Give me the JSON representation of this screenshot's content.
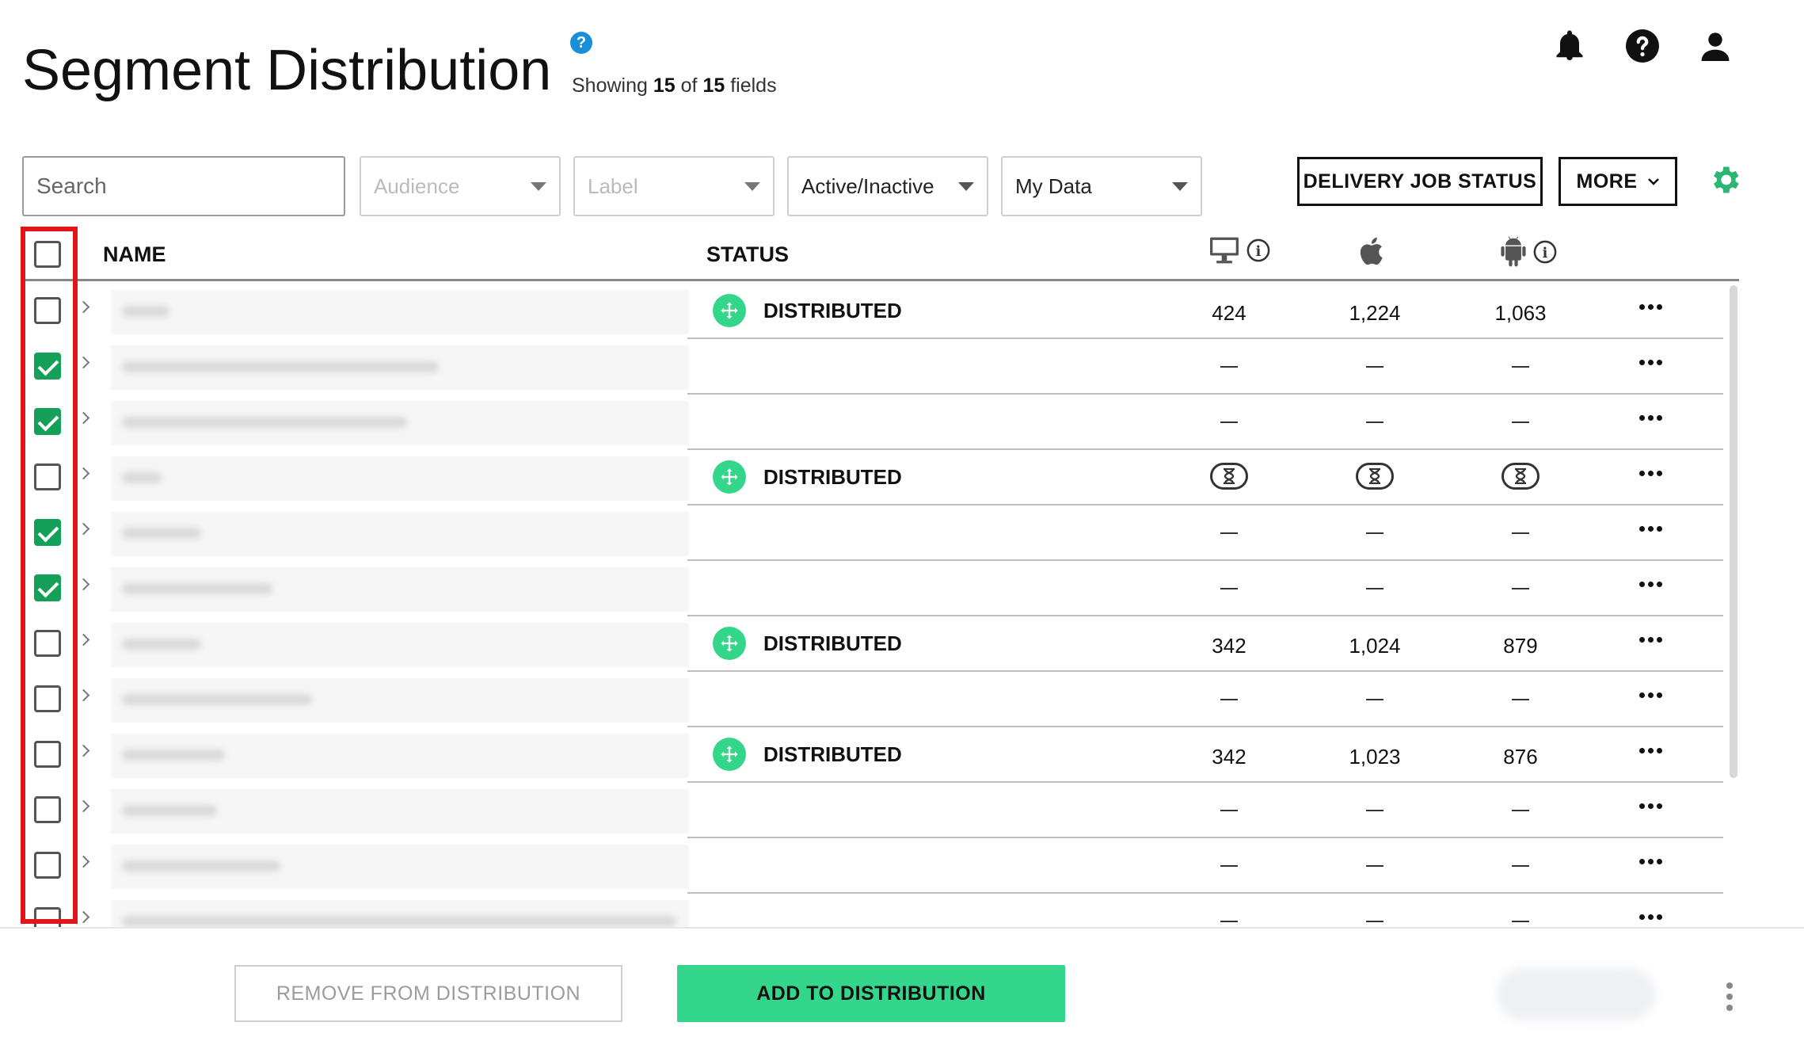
{
  "header": {
    "title": "Segment Distribution",
    "help_glyph": "?",
    "showing_prefix": "Showing",
    "showing_count": "15",
    "showing_of": "of",
    "showing_total": "15",
    "showing_suffix": "fields",
    "icons": [
      "bell-icon",
      "help-circle-icon",
      "user-icon"
    ]
  },
  "filters": {
    "search_placeholder": "Search",
    "audience": "Audience",
    "label": "Label",
    "active_inactive": "Active/Inactive",
    "my_data": "My Data"
  },
  "toolbar": {
    "delivery_job_status": "DELIVERY JOB STATUS",
    "more": "MORE",
    "settings_icon": "gear-icon",
    "accent_color": "#2bb673"
  },
  "table": {
    "columns": {
      "name": "NAME",
      "status": "STATUS",
      "desktop_icon": "desktop-icon",
      "apple_icon": "apple-icon",
      "android_icon": "android-icon",
      "info_glyph": "i"
    },
    "rows": [
      {
        "checked": false,
        "status": "DISTRIBUTED",
        "desktop": "424",
        "ios": "1,224",
        "android": "1,063"
      },
      {
        "checked": true,
        "status": "",
        "desktop": "—",
        "ios": "—",
        "android": "—"
      },
      {
        "checked": true,
        "status": "",
        "desktop": "—",
        "ios": "—",
        "android": "—"
      },
      {
        "checked": false,
        "status": "DISTRIBUTED",
        "desktop": "pending",
        "ios": "pending",
        "android": "pending"
      },
      {
        "checked": true,
        "status": "",
        "desktop": "—",
        "ios": "—",
        "android": "—"
      },
      {
        "checked": true,
        "status": "",
        "desktop": "—",
        "ios": "—",
        "android": "—"
      },
      {
        "checked": false,
        "status": "DISTRIBUTED",
        "desktop": "342",
        "ios": "1,024",
        "android": "879"
      },
      {
        "checked": false,
        "status": "",
        "desktop": "—",
        "ios": "—",
        "android": "—"
      },
      {
        "checked": false,
        "status": "DISTRIBUTED",
        "desktop": "342",
        "ios": "1,023",
        "android": "876"
      },
      {
        "checked": false,
        "status": "",
        "desktop": "—",
        "ios": "—",
        "android": "—"
      },
      {
        "checked": false,
        "status": "",
        "desktop": "—",
        "ios": "—",
        "android": "—"
      },
      {
        "checked": false,
        "status": "",
        "desktop": "—",
        "ios": "—",
        "android": "—"
      }
    ]
  },
  "footer": {
    "remove_label": "REMOVE FROM DISTRIBUTION",
    "add_label": "ADD TO DISTRIBUTION"
  },
  "colors": {
    "highlight": "#e0161b",
    "checkbox_checked": "#15a05a",
    "distributed_icon": "#34d68a",
    "add_button": "#33d68a"
  }
}
